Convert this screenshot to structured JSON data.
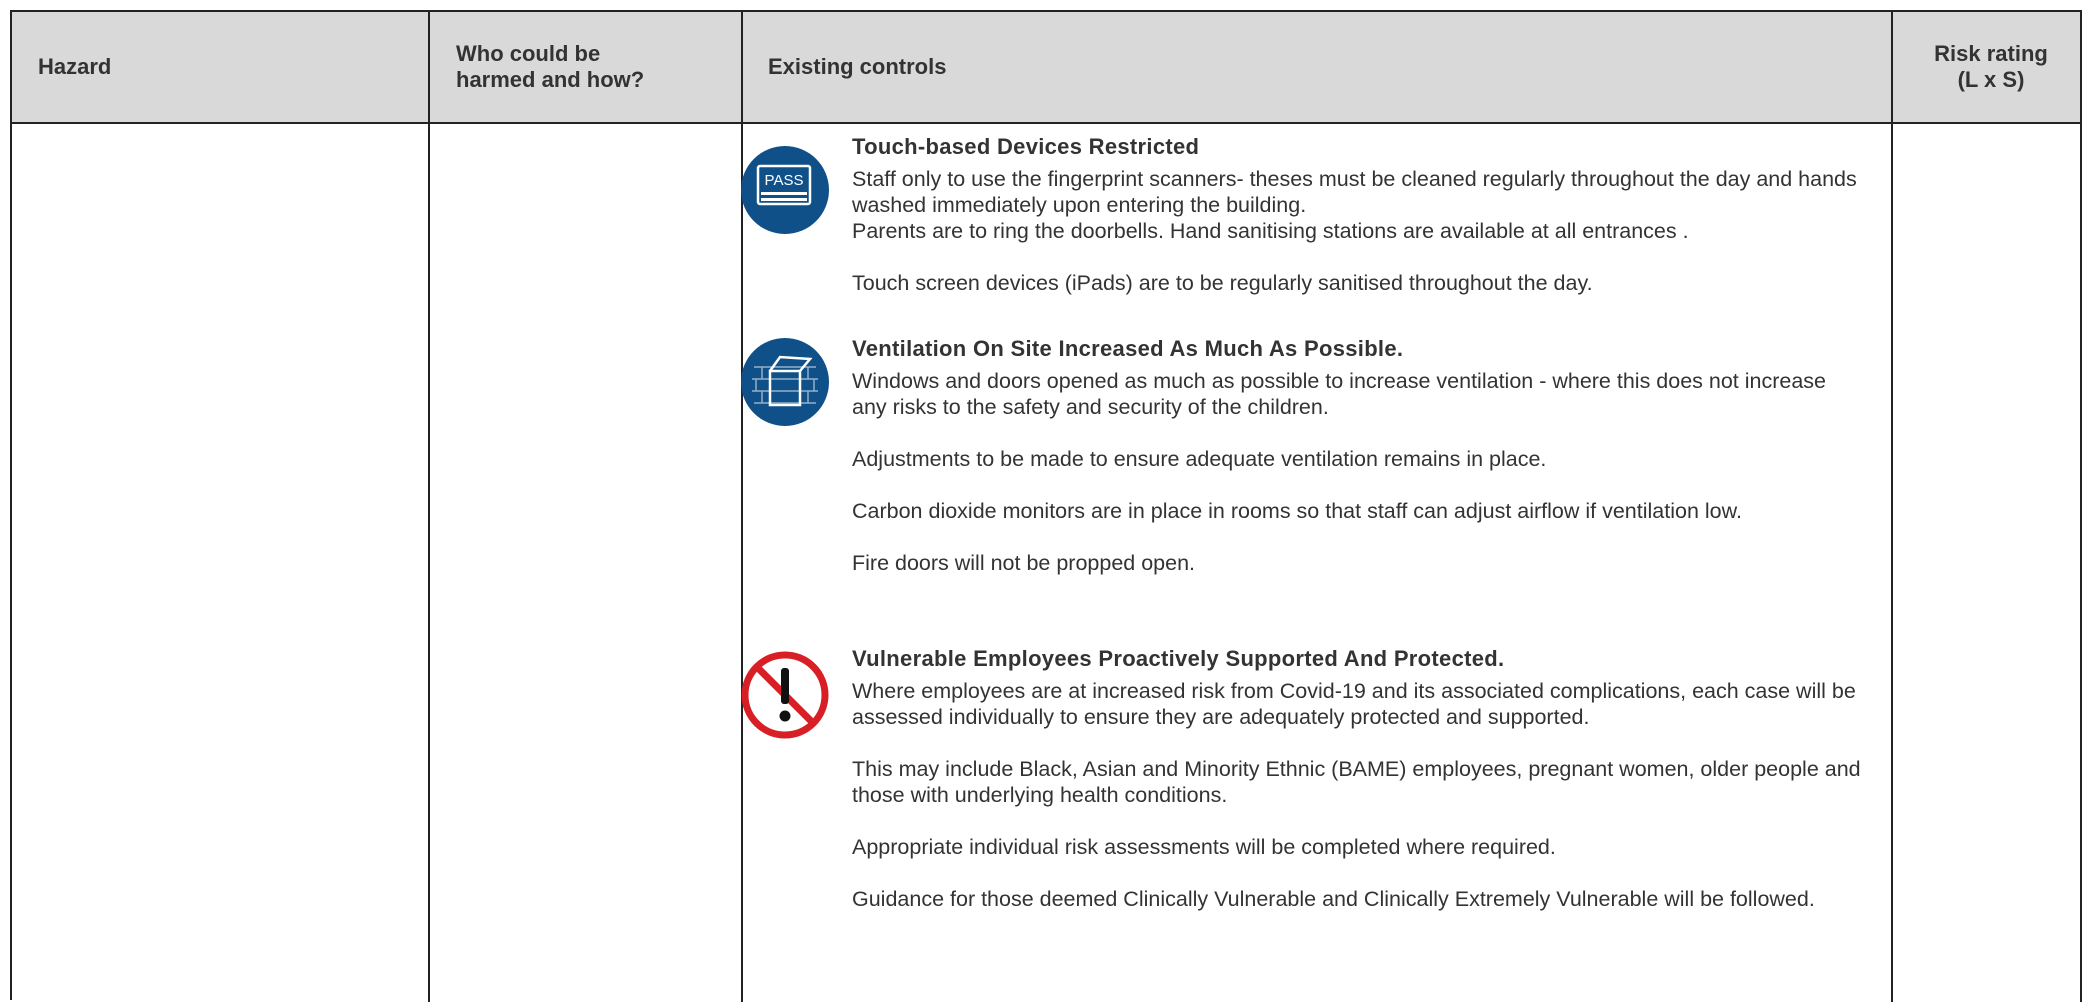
{
  "header": {
    "hazard": "Hazard",
    "who_line1": "Who could be",
    "who_line2": "harmed and how?",
    "existing_controls": "Existing controls",
    "risk_line1": "Risk rating",
    "risk_line2": "(L x S)"
  },
  "sections": [
    {
      "icon": "pass-card-icon",
      "title": "Touch-based Devices Restricted",
      "paragraphs": [
        "Staff only to use the fingerprint scanners- theses must be cleaned regularly throughout the day and hands washed immediately upon entering the building.",
        "Parents are to ring the doorbells. Hand sanitising stations are available at all entrances .",
        "Touch screen devices (iPads) are to be regularly sanitised throughout the day."
      ],
      "icon_label": "PASS"
    },
    {
      "icon": "open-window-icon",
      "title": "Ventilation On Site Increased As Much As Possible.",
      "paragraphs": [
        "Windows and doors opened as much as possible to increase ventilation - where this does not increase any risks to the safety and security of the children.",
        "Adjustments to be made to ensure adequate ventilation remains in place.",
        "Carbon dioxide monitors are in place in rooms so that staff can adjust airflow if ventilation low.",
        "Fire doors will not be propped open."
      ]
    },
    {
      "icon": "prohibited-exclamation-icon",
      "title": "Vulnerable Employees Proactively Supported And Protected.",
      "paragraphs": [
        "Where employees are at increased risk from Covid-19 and its associated complications, each case will be assessed individually to ensure they are adequately protected and supported.",
        "This may include Black, Asian and Minority Ethnic (BAME) employees, pregnant women, older people and those with underlying health conditions.",
        "Appropriate individual risk assessments will be completed where required.",
        "Guidance for those deemed Clinically Vulnerable and Clinically Extremely Vulnerable will be followed."
      ]
    }
  ],
  "colors": {
    "header_bg": "#d9d9d9",
    "icon_blue": "#0f5089",
    "icon_red": "#d81f26",
    "text": "#333333"
  }
}
